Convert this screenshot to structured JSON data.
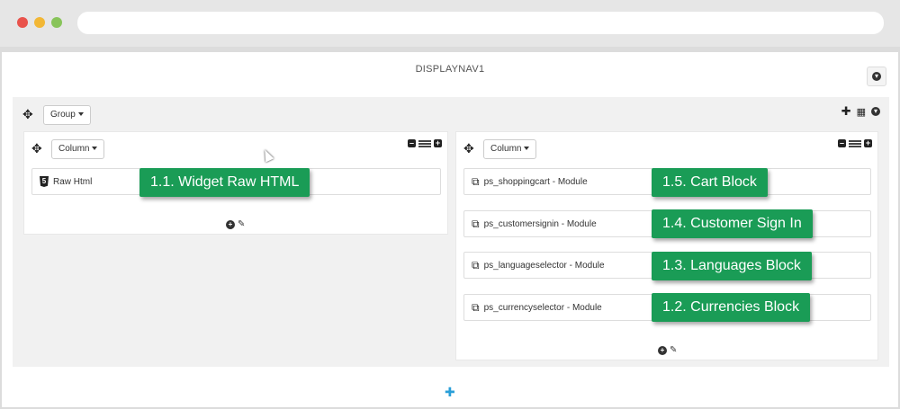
{
  "page": {
    "title": "DISPLAYNAV1"
  },
  "group": {
    "dropdown_label": "Group"
  },
  "columns": [
    {
      "dropdown_label": "Column"
    },
    {
      "dropdown_label": "Column"
    }
  ],
  "widgets_left": [
    {
      "label": "Raw Html",
      "callout": "1.1. Widget Raw HTML"
    }
  ],
  "widgets_right": [
    {
      "label": "ps_shoppingcart - Module",
      "callout": "1.5. Cart Block"
    },
    {
      "label": "ps_customersignin - Module",
      "callout": "1.4. Customer Sign In"
    },
    {
      "label": "ps_languageselector - Module",
      "callout": "1.3. Languages Block"
    },
    {
      "label": "ps_currencyselector - Module",
      "callout": "1.2. Currencies Block"
    }
  ],
  "icons": {
    "move": "move-icon",
    "plus": "plus-icon",
    "grid": "grid-icon",
    "down": "circle-down-icon",
    "minus": "minus-square-icon",
    "edit": "pencil-icon",
    "module": "copy-icon",
    "html5": "html5-icon"
  },
  "colors": {
    "callout": "#1a9c56",
    "add_blue": "#2a9fd8"
  }
}
